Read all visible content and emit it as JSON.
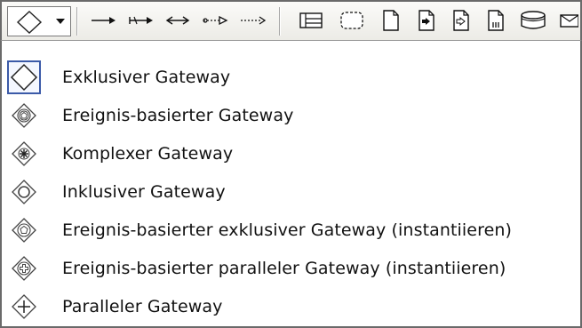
{
  "toolbar": {
    "combo": {
      "icon": "exclusive-gateway-icon",
      "arrow": "dropdown-arrow-icon"
    },
    "buttons": [
      {
        "name": "sequence-flow-icon"
      },
      {
        "name": "message-flow-icon"
      },
      {
        "name": "association-both-icon"
      },
      {
        "name": "association-one-icon"
      },
      {
        "name": "association-icon"
      },
      {
        "name": "lane-icon"
      },
      {
        "name": "group-icon"
      },
      {
        "name": "data-object-icon"
      },
      {
        "name": "data-input-icon"
      },
      {
        "name": "data-output-icon"
      },
      {
        "name": "data-collection-icon"
      },
      {
        "name": "data-store-icon"
      },
      {
        "name": "message-icon"
      }
    ]
  },
  "menu": {
    "items": [
      {
        "label": "Exklusiver Gateway",
        "icon": "exclusive-gateway-icon",
        "selected": true
      },
      {
        "label": "Ereignis-basierter Gateway",
        "icon": "event-based-gateway-icon",
        "selected": false
      },
      {
        "label": "Komplexer Gateway",
        "icon": "complex-gateway-icon",
        "selected": false
      },
      {
        "label": "Inklusiver Gateway",
        "icon": "inclusive-gateway-icon",
        "selected": false
      },
      {
        "label": "Ereignis-basierter exklusiver Gateway (instantiieren)",
        "icon": "event-based-exclusive-instantiate-gateway-icon",
        "selected": false
      },
      {
        "label": "Ereignis-basierter paralleler Gateway (instantiieren)",
        "icon": "event-based-parallel-instantiate-gateway-icon",
        "selected": false
      },
      {
        "label": "Paralleler Gateway",
        "icon": "parallel-gateway-icon",
        "selected": false
      }
    ]
  }
}
